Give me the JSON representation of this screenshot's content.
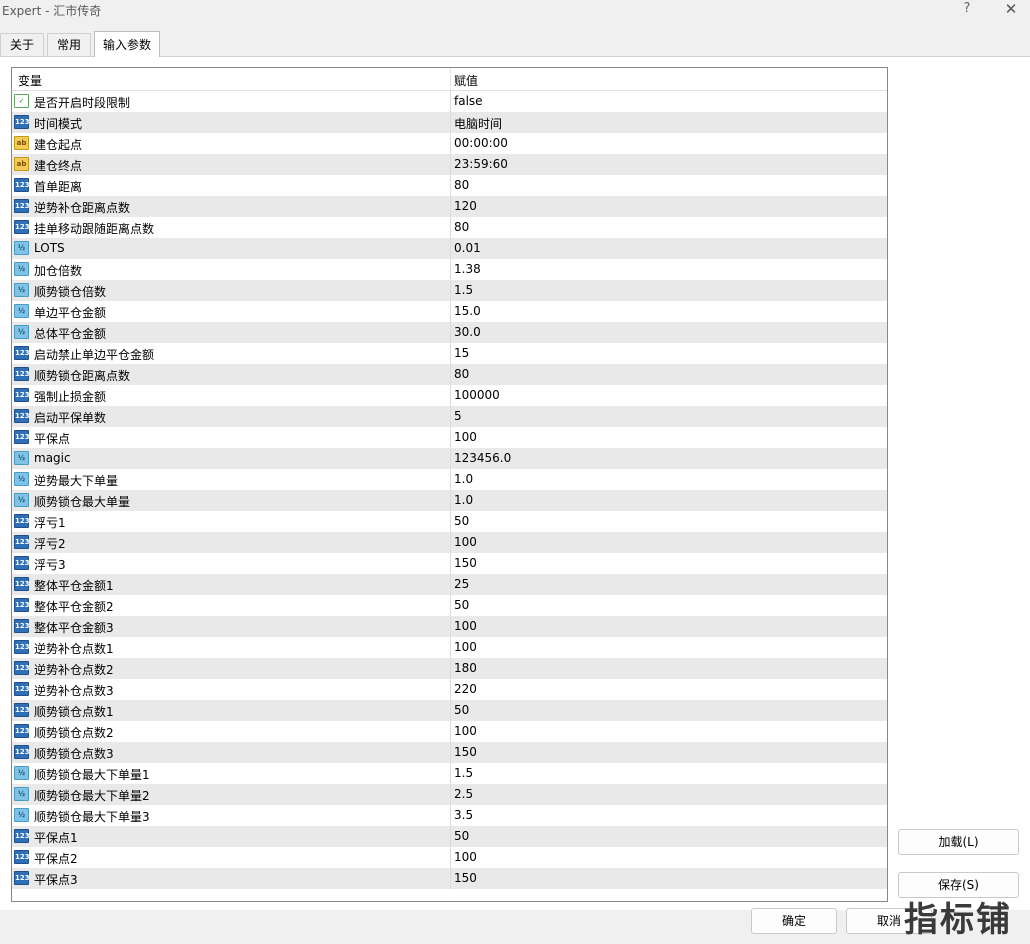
{
  "window": {
    "title": "Expert - 汇市传奇",
    "help": "?",
    "close": "✕"
  },
  "tabs": [
    "关于",
    "常用",
    "输入参数"
  ],
  "table": {
    "col_variable": "变量",
    "col_value": "赋值",
    "rows": [
      {
        "type": "bool",
        "icon": "bool-icon",
        "name": "是否开启时段限制",
        "value": "false"
      },
      {
        "type": "int",
        "icon": "int-icon",
        "name": "时间模式",
        "value": "电脑时间"
      },
      {
        "type": "str",
        "icon": "string-icon",
        "name": "建仓起点",
        "value": "00:00:00"
      },
      {
        "type": "str",
        "icon": "string-icon",
        "name": "建仓终点",
        "value": "23:59:60"
      },
      {
        "type": "int",
        "icon": "int-icon",
        "name": "首单距离",
        "value": "80"
      },
      {
        "type": "int",
        "icon": "int-icon",
        "name": "逆势补仓距离点数",
        "value": "120"
      },
      {
        "type": "int",
        "icon": "int-icon",
        "name": "挂单移动跟随距离点数",
        "value": "80"
      },
      {
        "type": "dbl",
        "icon": "double-icon",
        "name": "LOTS",
        "value": "0.01"
      },
      {
        "type": "dbl",
        "icon": "double-icon",
        "name": "加仓倍数",
        "value": "1.38"
      },
      {
        "type": "dbl",
        "icon": "double-icon",
        "name": "顺势锁仓倍数",
        "value": "1.5"
      },
      {
        "type": "dbl",
        "icon": "double-icon",
        "name": "单边平仓金额",
        "value": "15.0"
      },
      {
        "type": "dbl",
        "icon": "double-icon",
        "name": "总体平仓金额",
        "value": "30.0"
      },
      {
        "type": "int",
        "icon": "int-icon",
        "name": "启动禁止单边平仓金额",
        "value": "15"
      },
      {
        "type": "int",
        "icon": "int-icon",
        "name": "顺势锁仓距离点数",
        "value": "80"
      },
      {
        "type": "int",
        "icon": "int-icon",
        "name": "强制止损金额",
        "value": "100000"
      },
      {
        "type": "int",
        "icon": "int-icon",
        "name": "启动平保单数",
        "value": "5"
      },
      {
        "type": "int",
        "icon": "int-icon",
        "name": "平保点",
        "value": "100"
      },
      {
        "type": "dbl",
        "icon": "double-icon",
        "name": "magic",
        "value": "123456.0"
      },
      {
        "type": "dbl",
        "icon": "double-icon",
        "name": "逆势最大下单量",
        "value": "1.0"
      },
      {
        "type": "dbl",
        "icon": "double-icon",
        "name": "顺势锁仓最大单量",
        "value": "1.0"
      },
      {
        "type": "int",
        "icon": "int-icon",
        "name": "浮亏1",
        "value": "50"
      },
      {
        "type": "int",
        "icon": "int-icon",
        "name": "浮亏2",
        "value": "100"
      },
      {
        "type": "int",
        "icon": "int-icon",
        "name": "浮亏3",
        "value": "150"
      },
      {
        "type": "int",
        "icon": "int-icon",
        "name": "整体平仓金额1",
        "value": "25"
      },
      {
        "type": "int",
        "icon": "int-icon",
        "name": "整体平仓金额2",
        "value": "50"
      },
      {
        "type": "int",
        "icon": "int-icon",
        "name": "整体平仓金额3",
        "value": "100"
      },
      {
        "type": "int",
        "icon": "int-icon",
        "name": "逆势补仓点数1",
        "value": "100"
      },
      {
        "type": "int",
        "icon": "int-icon",
        "name": "逆势补仓点数2",
        "value": "180"
      },
      {
        "type": "int",
        "icon": "int-icon",
        "name": "逆势补仓点数3",
        "value": "220"
      },
      {
        "type": "int",
        "icon": "int-icon",
        "name": "顺势锁仓点数1",
        "value": "50"
      },
      {
        "type": "int",
        "icon": "int-icon",
        "name": "顺势锁仓点数2",
        "value": "100"
      },
      {
        "type": "int",
        "icon": "int-icon",
        "name": "顺势锁仓点数3",
        "value": "150"
      },
      {
        "type": "dbl",
        "icon": "double-icon",
        "name": "顺势锁仓最大下单量1",
        "value": "1.5"
      },
      {
        "type": "dbl",
        "icon": "double-icon",
        "name": "顺势锁仓最大下单量2",
        "value": "2.5"
      },
      {
        "type": "dbl",
        "icon": "double-icon",
        "name": "顺势锁仓最大下单量3",
        "value": "3.5"
      },
      {
        "type": "int",
        "icon": "int-icon",
        "name": "平保点1",
        "value": "50"
      },
      {
        "type": "int",
        "icon": "int-icon",
        "name": "平保点2",
        "value": "100"
      },
      {
        "type": "int",
        "icon": "int-icon",
        "name": "平保点3",
        "value": "150"
      }
    ]
  },
  "buttons": {
    "load": "加载(L)",
    "save": "保存(S)",
    "ok": "确定",
    "cancel": "取消"
  },
  "watermark": "指标铺"
}
